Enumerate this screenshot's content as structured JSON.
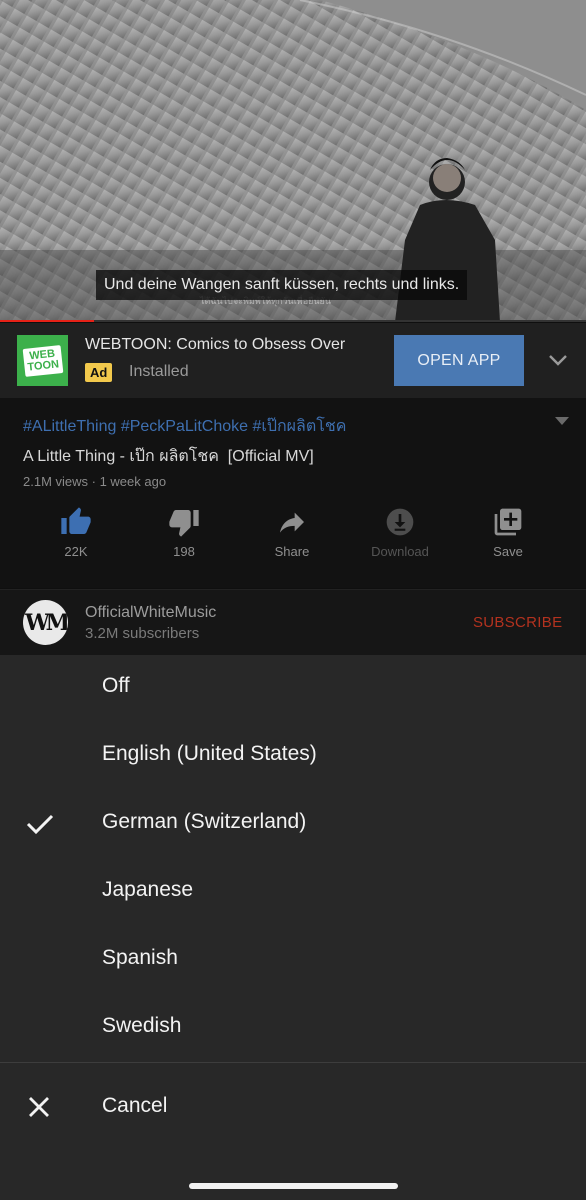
{
  "video": {
    "caption": "Und deine Wangen sanft küssen, rechts und links.",
    "burned_subtitle": "ได้ฉันไปจะพิมพ์ให้ทุกวันเพื่อยืนยัน",
    "progress_percent": 16
  },
  "ad": {
    "logo_text_line1": "WEB",
    "logo_text_line2": "TOON",
    "title": "WEBTOON: Comics to Obsess Over",
    "badge": "Ad",
    "status": "Installed",
    "cta": "OPEN APP",
    "expand_icon": "chevron-down-icon"
  },
  "video_meta": {
    "hashtags": "#ALittleThing #PeckPaLitChoke #เป๊กผลิตโชค",
    "title": "A Little Thing - เป๊ก ผลิตโชค  [Official MV]",
    "views": "2.1M views · 1 week ago",
    "actions": {
      "like": "22K",
      "dislike": "198",
      "share": "Share",
      "download": "Download",
      "save": "Save"
    },
    "accent_color": "#3e6fb0"
  },
  "channel": {
    "avatar_text": "WM",
    "name": "OfficialWhiteMusic",
    "subscribers": "3.2M subscribers",
    "subscribe": "SUBSCRIBE"
  },
  "captions_menu": {
    "options": [
      {
        "label": "Off",
        "selected": false
      },
      {
        "label": "English (United States)",
        "selected": false
      },
      {
        "label": "German (Switzerland)",
        "selected": true
      },
      {
        "label": "Japanese",
        "selected": false
      },
      {
        "label": "Spanish",
        "selected": false
      },
      {
        "label": "Swedish",
        "selected": false
      }
    ],
    "cancel": "Cancel"
  }
}
